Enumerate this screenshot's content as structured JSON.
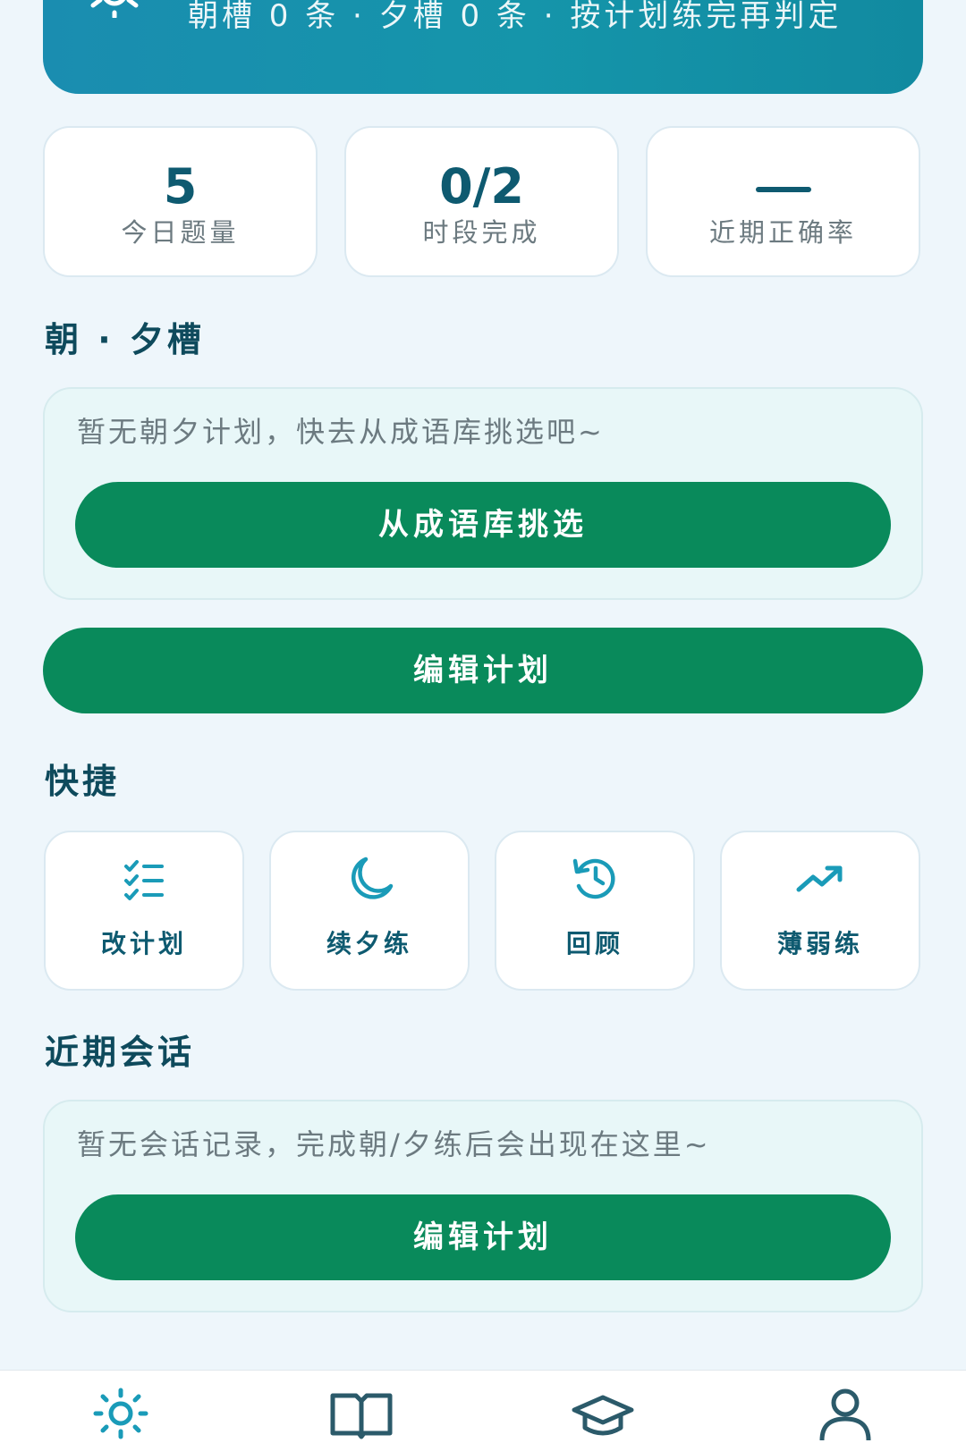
{
  "banner": {
    "text": "朝槽 0 条 · 夕槽 0 条 · 按计划练完再判定",
    "icon": "sun-icon"
  },
  "stats": [
    {
      "value": "5",
      "label": "今日题量"
    },
    {
      "value": "0/2",
      "label": "时段完成"
    },
    {
      "value": "",
      "label": "近期正确率",
      "display": "dash"
    }
  ],
  "plan_section": {
    "title": "朝 · 夕槽",
    "empty_text": "暂无朝夕计划，快去从成语库挑选吧~",
    "pick_button": "从成语库挑选",
    "edit_button": "编辑计划"
  },
  "quick_section": {
    "title": "快捷",
    "items": [
      {
        "label": "改计划",
        "icon": "checklist-icon"
      },
      {
        "label": "续夕练",
        "icon": "moon-icon"
      },
      {
        "label": "回顾",
        "icon": "history-icon"
      },
      {
        "label": "薄弱练",
        "icon": "trending-up-icon"
      }
    ]
  },
  "sessions_section": {
    "title": "近期会话",
    "empty_text": "暂无会话记录，完成朝/夕练后会出现在这里~",
    "edit_button": "编辑计划"
  },
  "tabbar": {
    "tabs": [
      {
        "icon": "sun-icon",
        "active": true
      },
      {
        "icon": "book-icon",
        "active": false
      },
      {
        "icon": "graduation-cap-icon",
        "active": false
      },
      {
        "icon": "user-icon",
        "active": false
      }
    ]
  },
  "colors": {
    "accent_green": "#098a5b",
    "banner_blue": "#1595aa",
    "heading": "#0e4a5c",
    "muted_text": "#6c7a80"
  }
}
